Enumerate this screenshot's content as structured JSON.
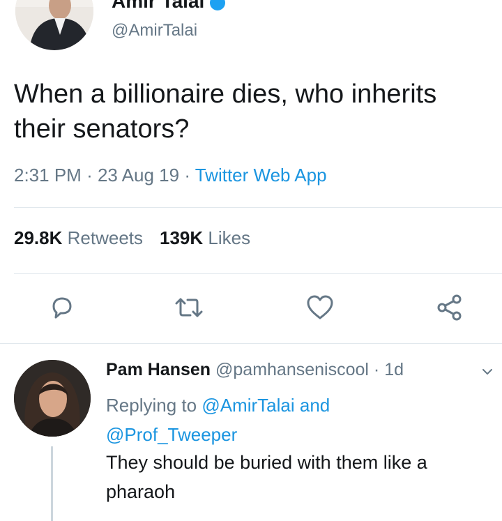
{
  "author": {
    "name": "Amir Talai",
    "handle": "@AmirTalai"
  },
  "tweet": {
    "text": "When a billionaire dies, who inherits their senators?",
    "time": "2:31 PM",
    "date": "23 Aug 19",
    "app": "Twitter Web App"
  },
  "stats": {
    "retweets_count": "29.8K",
    "retweets_label": "Retweets",
    "likes_count": "139K",
    "likes_label": "Likes"
  },
  "actions": [
    "reply-icon",
    "retweet-icon",
    "like-icon",
    "share-icon"
  ],
  "reply": {
    "name": "Pam Hansen",
    "handle": "@pamhanseniscool",
    "age": "1d",
    "replying_prefix": "Replying to",
    "mention1": "@AmirTalai",
    "and": "and",
    "mention2": "@Prof_Tweeper",
    "text": "They should be buried with them like a pharaoh"
  },
  "colors": {
    "link": "#1b95e0",
    "muted": "#657786",
    "text": "#14171a",
    "verified": "#1da1f2"
  }
}
